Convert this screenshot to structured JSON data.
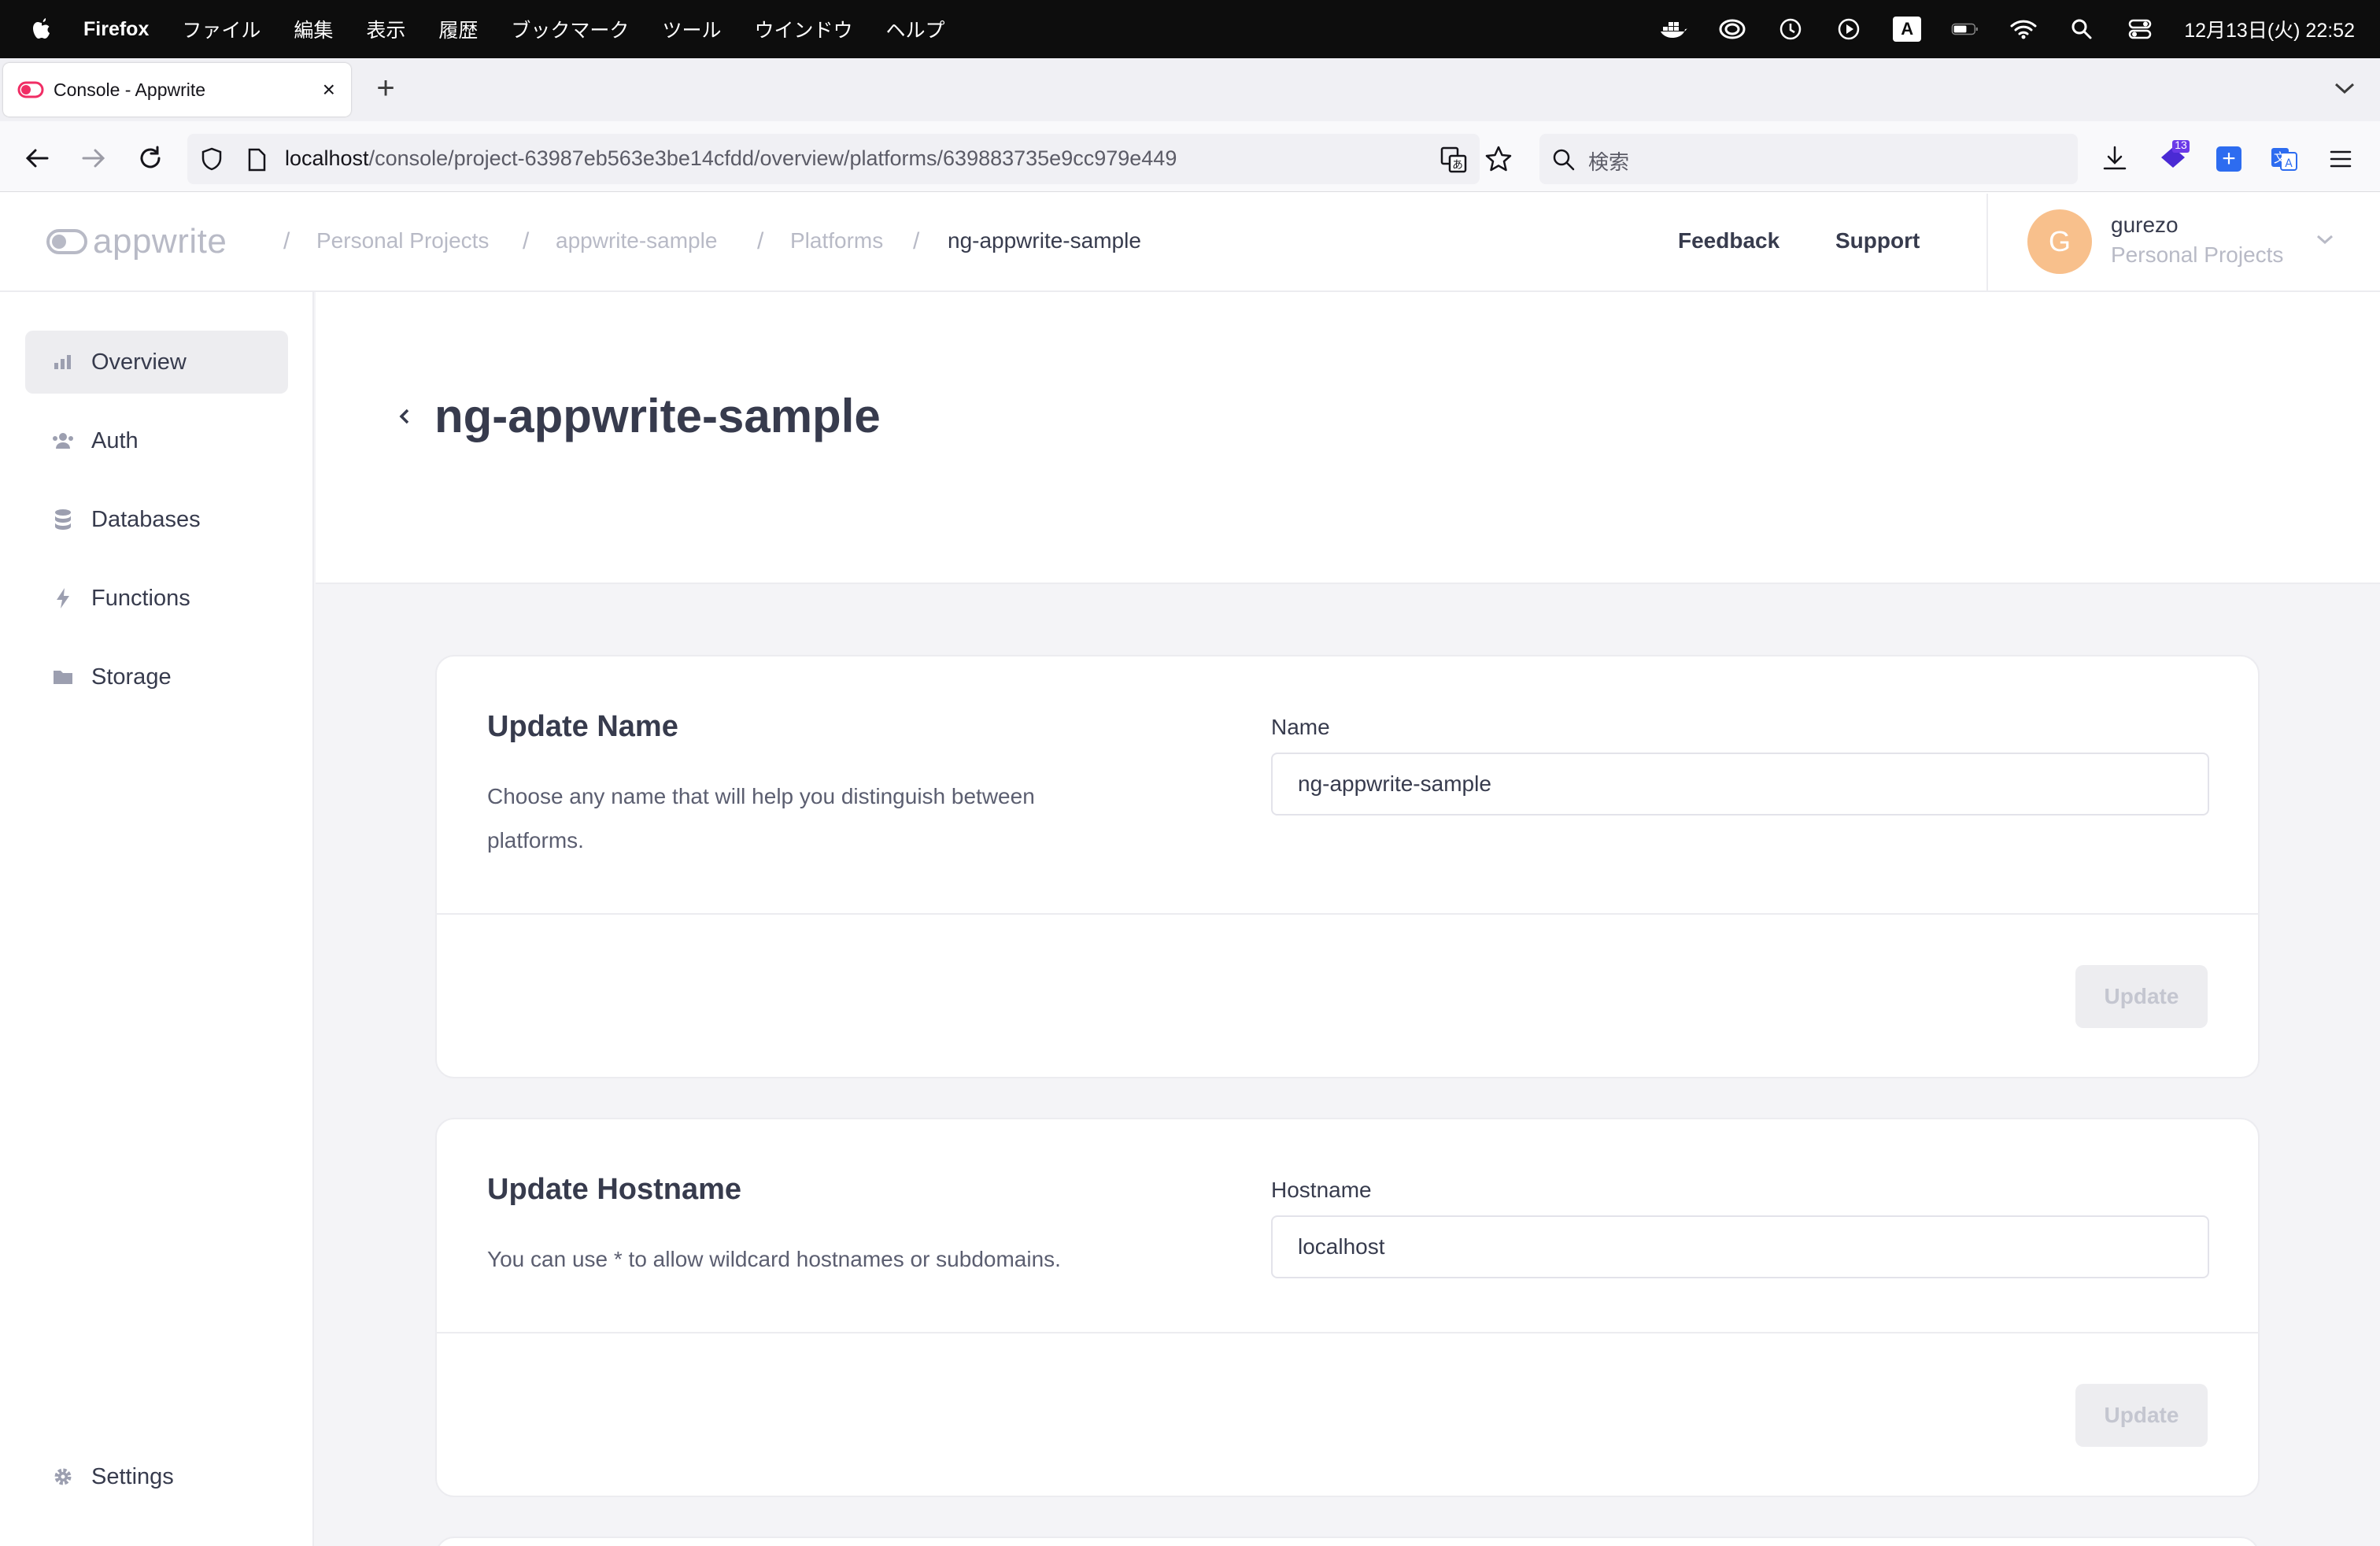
{
  "menubar": {
    "app_name": "Firefox",
    "items": [
      "ファイル",
      "編集",
      "表示",
      "履歴",
      "ブックマーク",
      "ツール",
      "ウインドウ",
      "ヘルプ"
    ],
    "input_mode": "A",
    "clock": "12月13日(火) 22:52"
  },
  "browser": {
    "tab_title": "Console - Appwrite",
    "new_tab": "+",
    "url_host": "localhost",
    "url_path": "/console/project-63987eb563e3be14cfdd/overview/platforms/639883735e9cc979e449",
    "search_placeholder": "検索",
    "extension_badge": "13"
  },
  "header": {
    "logo_text": "appwrite",
    "breadcrumbs": [
      "Personal Projects",
      "appwrite-sample",
      "Platforms",
      "ng-appwrite-sample"
    ],
    "feedback": "Feedback",
    "support": "Support",
    "avatar_initial": "G",
    "user_name": "gurezo",
    "user_org": "Personal Projects"
  },
  "sidebar": {
    "items": [
      {
        "label": "Overview",
        "icon": "chart-bars-icon",
        "active": true
      },
      {
        "label": "Auth",
        "icon": "users-icon"
      },
      {
        "label": "Databases",
        "icon": "database-icon"
      },
      {
        "label": "Functions",
        "icon": "lightning-icon"
      },
      {
        "label": "Storage",
        "icon": "folder-icon"
      }
    ],
    "settings": "Settings"
  },
  "page": {
    "title": "ng-appwrite-sample"
  },
  "cards": {
    "name": {
      "title": "Update Name",
      "description": "Choose any name that will help you distinguish between platforms.",
      "field_label": "Name",
      "value": "ng-appwrite-sample",
      "button": "Update"
    },
    "hostname": {
      "title": "Update Hostname",
      "description": "You can use * to allow wildcard hostnames or subdomains.",
      "field_label": "Hostname",
      "value": "localhost",
      "button": "Update"
    }
  },
  "colors": {
    "accent": "#f02e65",
    "text": "#373b4d",
    "muted": "#b8bac6",
    "avatar": "#f8c08c"
  }
}
